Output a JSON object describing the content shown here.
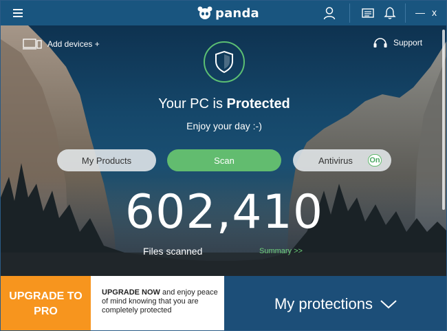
{
  "app": {
    "logo_text": "panda"
  },
  "titlebar": {
    "icons": [
      "menu-icon",
      "user-icon",
      "news-icon",
      "bell-icon"
    ],
    "minimize": "—",
    "close": "x"
  },
  "header": {
    "add_devices": "Add devices +",
    "support": "Support"
  },
  "status": {
    "prefix": "Your PC is ",
    "state": "Protected",
    "subtitle": "Enjoy your day :-)"
  },
  "buttons": {
    "products": "My Products",
    "scan": "Scan",
    "antivirus": "Antivirus",
    "antivirus_toggle": "On"
  },
  "stats": {
    "files_scanned": "602,410",
    "files_label": "Files scanned",
    "summary_link": "Summary >>"
  },
  "footer": {
    "upgrade_button": "UPGRADE TO PRO",
    "upgrade_bold": "UPGRADE NOW",
    "upgrade_text": " and enjoy peace of mind knowing that you are completely protected",
    "protections": "My protections"
  },
  "colors": {
    "accent_green": "#62bc6f",
    "titlebar": "#19557f",
    "upgrade_orange": "#f7951e",
    "protections_bg": "#1c4e78"
  }
}
